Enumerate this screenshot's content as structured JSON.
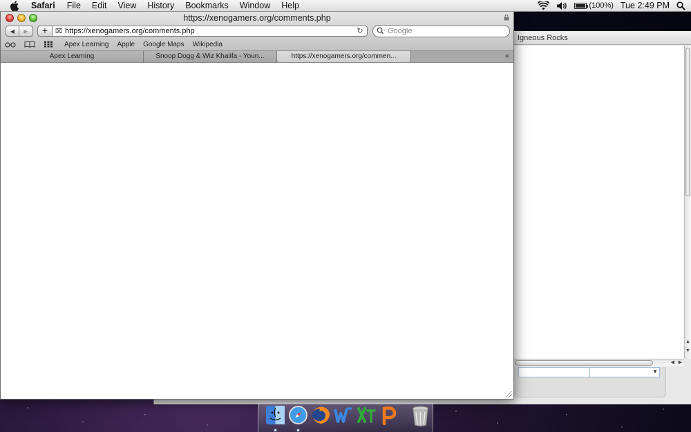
{
  "menubar": {
    "app_name": "Safari",
    "items": [
      "File",
      "Edit",
      "View",
      "History",
      "Bookmarks",
      "Window",
      "Help"
    ],
    "battery_text": "(100%)",
    "battery_level": 1.0,
    "clock": "Tue 2:49 PM"
  },
  "window": {
    "title": "https://xenogamers.org/comments.php"
  },
  "toolbar": {
    "add_label": "+",
    "url": "https://xenogamers.org/comments.php",
    "search_placeholder": "Google"
  },
  "bookmarks": {
    "links": [
      "Apex Learning",
      "Apple",
      "Google Maps",
      "Wikipedia"
    ]
  },
  "tabs": [
    {
      "label": "Apex Learning"
    },
    {
      "label": "Snoop Dogg & Wiz Khalifa - Youn..."
    },
    {
      "label": "https://xenogamers.org/commen..."
    }
  ],
  "tab_add_label": "+",
  "background_window": {
    "tab_label": "Igneous Rocks"
  },
  "colors": {
    "close": "#e8443a",
    "minimize": "#f0b52a",
    "zoom": "#5dc43a"
  },
  "dock": {
    "apps": [
      "finder",
      "safari",
      "firefox",
      "word",
      "excel",
      "powerpoint",
      "trash"
    ]
  }
}
